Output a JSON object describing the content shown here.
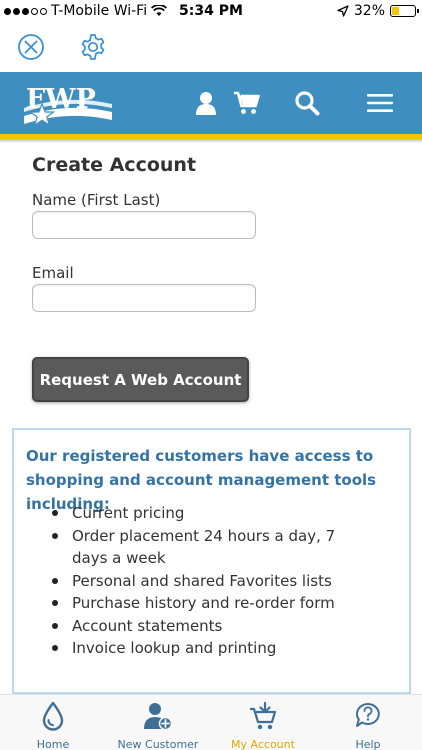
{
  "status_bar": {
    "carrier": "T-Mobile Wi-Fi",
    "time": "5:34 PM",
    "battery": "32%",
    "battery_level": 0.32
  },
  "header": {
    "logo_text": "FWP"
  },
  "form": {
    "title": "Create Account",
    "name_label": "Name (First Last)",
    "name_value": "",
    "email_label": "Email",
    "email_value": "",
    "submit_label": "Request A Web Account"
  },
  "info": {
    "heading": "Our registered customers have access to shopping and account management tools including:",
    "items": [
      "Current pricing",
      "Order placement 24 hours a day, 7 days a week",
      "Personal and shared Favorites lists",
      "Purchase history and re-order form",
      "Account statements",
      "Invoice lookup and printing"
    ]
  },
  "tabs": [
    {
      "label": "Home",
      "icon": "drop-icon",
      "active": false
    },
    {
      "label": "New Customer",
      "icon": "add-user-icon",
      "active": false
    },
    {
      "label": "My Account",
      "icon": "cart-add-icon",
      "active": true
    },
    {
      "label": "Help",
      "icon": "help-bubble-icon",
      "active": false
    }
  ],
  "colors": {
    "header_blue": "#3e8fc0",
    "accent_yellow": "#f2c500",
    "heading_blue": "#3473a3",
    "button_gray": "#5a5a5a",
    "active_tab": "#e0a800"
  }
}
